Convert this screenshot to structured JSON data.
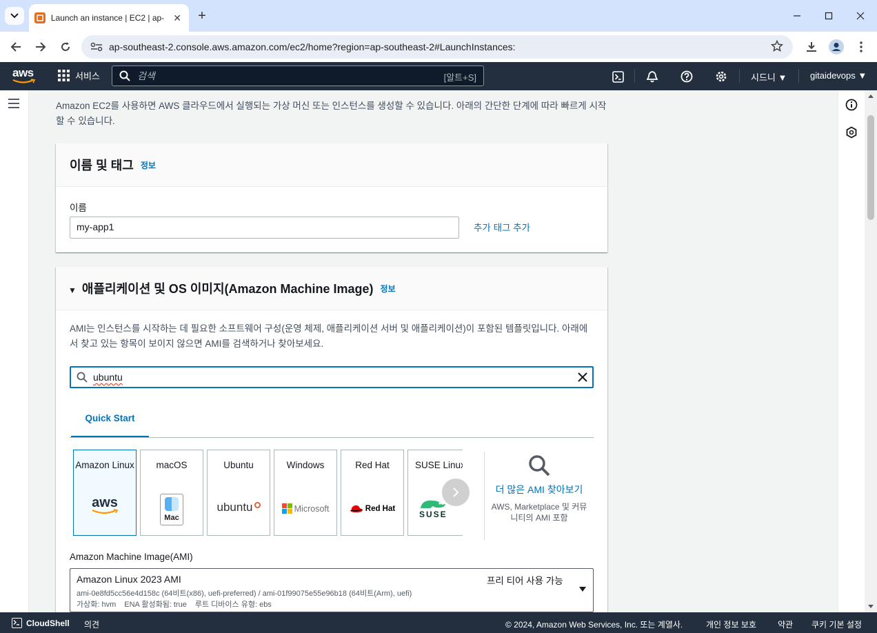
{
  "browser": {
    "tab_title": "Launch an instance | EC2 | ap-",
    "url": "ap-southeast-2.console.aws.amazon.com/ec2/home?region=ap-southeast-2#LaunchInstances:"
  },
  "aws_header": {
    "logo": "aws",
    "services_label": "서비스",
    "search_placeholder": "검색",
    "search_shortcut": "[알트+S]",
    "region_label": "시드니",
    "account_label": "gitaidevops"
  },
  "intro_text": "Amazon EC2를 사용하면 AWS 클라우드에서 실행되는 가상 머신 또는 인스턴스를 생성할 수 있습니다. 아래의 간단한 단계에 따라 빠르게 시작할 수 있습니다.",
  "name_tags": {
    "title": "이름 및 태그",
    "info": "정보",
    "name_label": "이름",
    "name_value": "my-app1",
    "add_tags": "추가 태그 추가"
  },
  "ami": {
    "title": "애플리케이션 및 OS 이미지(Amazon Machine Image)",
    "info": "정보",
    "description": "AMI는 인스턴스를 시작하는 데 필요한 소프트웨어 구성(운영 체제, 애플리케이션 서버 및 애플리케이션)이 포함된 템플릿입니다. 아래에서 찾고 있는 항목이 보이지 않으면 AMI를 검색하거나 찾아보세요.",
    "search_value": "ubuntu",
    "quick_start_tab": "Quick Start",
    "os_cards": [
      {
        "name": "Amazon Linux",
        "logo_text": "aws"
      },
      {
        "name": "macOS",
        "logo_text": "Mac"
      },
      {
        "name": "Ubuntu",
        "logo_text": "ubuntu"
      },
      {
        "name": "Windows",
        "logo_text": "Microsoft"
      },
      {
        "name": "Red Hat",
        "logo_text": "Red Hat"
      },
      {
        "name": "SUSE Linux",
        "logo_text": "SUSE"
      }
    ],
    "more_link": "더 많은 AMI 찾아보기",
    "more_sub": "AWS, Marketplace 및 커뮤니티의 AMI 포함",
    "ami_label": "Amazon Machine Image(AMI)",
    "selected": {
      "name": "Amazon Linux 2023 AMI",
      "free_tier": "프리 티어 사용 가능",
      "ids": "ami-0e8fd5cc56e4d158c (64비트(x86), uefi-preferred) / ami-01f99075e55e96b18 (64비트(Arm), uefi)",
      "virtualization": "가상화: hvm",
      "ena": "ENA 활성화됨: true",
      "root_device": "루트 디바이스 유형: ebs"
    }
  },
  "footer": {
    "cloudshell": "CloudShell",
    "feedback": "의견",
    "copyright": "© 2024, Amazon Web Services, Inc. 또는 계열사.",
    "privacy": "개인 정보 보호",
    "terms": "약관",
    "cookies": "쿠키 기본 설정"
  },
  "colors": {
    "aws_nav": "#232f3e",
    "link_blue": "#0073bb",
    "aws_orange": "#ff9900"
  }
}
